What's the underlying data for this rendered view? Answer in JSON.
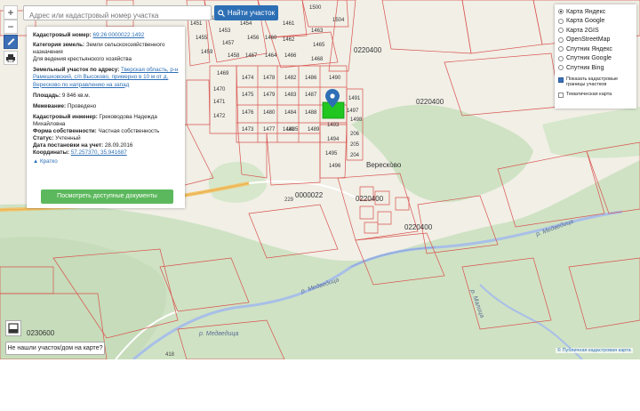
{
  "search": {
    "placeholder": "Адрес или кадастровый номер участка",
    "button_label": "Найти участок"
  },
  "controls": {
    "zoom_in": "+",
    "zoom_out": "−"
  },
  "info_panel": {
    "cadastral_number_label": "Кадастровый номер:",
    "cadastral_number": "69:26:0000022:1492",
    "land_category_label": "Категория земель:",
    "land_category": "Земли сельскохозяйственного назначения",
    "permitted_use": "Для ведения крестьянского хозяйства",
    "address_label": "Земельный участок по адресу:",
    "address": "Тверская область, р-н Рамешковский, с/п Высоково, примерно в 10 м от д. Верескoво по направлению на запад",
    "area_label": "Площадь:",
    "area": "9 846 кв.м.",
    "survey_label": "Межевание:",
    "survey": "Проведено",
    "engineer_label": "Кадастровый инженер:",
    "engineer": "Греководова Надежда Михайловна",
    "ownership_label": "Форма собственности:",
    "ownership": "Частная собственность",
    "status_label": "Статус:",
    "status": "Учтенный",
    "registered_label": "Дата постановки на учет:",
    "registered": "28.09.2016",
    "coords_label": "Координаты:",
    "coords": "57.257370, 35.941687",
    "collapse_label": "Кратко",
    "docs_button": "Посмотреть доступные документы"
  },
  "layers": {
    "options": [
      {
        "label": "Карта Яндекс",
        "selected": true
      },
      {
        "label": "Карта Google",
        "selected": false
      },
      {
        "label": "Карта 2GIS",
        "selected": false
      },
      {
        "label": "OpenStreetMap",
        "selected": false
      },
      {
        "label": "Спутник Яндекс",
        "selected": false
      },
      {
        "label": "Спутник Google",
        "selected": false
      },
      {
        "label": "Спутник Bing",
        "selected": false
      }
    ],
    "show_boundaries": "Показать кадастровые границы участков",
    "show_boundaries_checked": true,
    "thematic_map": "Тематическая карта",
    "thematic_map_checked": false
  },
  "map": {
    "parcels": [
      "1500",
      "1461",
      "1463",
      "1465",
      "1462",
      "1464",
      "1466",
      "1468",
      "1467",
      "1469",
      "1470",
      "1471",
      "1472",
      "1473",
      "1474",
      "1475",
      "1476",
      "1477",
      "1478",
      "1479",
      "1480",
      "1481",
      "1482",
      "1483",
      "1484",
      "1485",
      "1486",
      "1487",
      "1488",
      "1489",
      "1490",
      "1491",
      "1493",
      "1494",
      "1495",
      "1496",
      "1497",
      "1498",
      "206",
      "205",
      "204",
      "1504",
      "1454",
      "1456",
      "1457",
      "1458",
      "1459",
      "1460",
      "1451",
      "1452",
      "1453",
      "1455"
    ],
    "quarters": [
      "0220400",
      "0220400",
      "0000022",
      "0220400",
      "0220400",
      "0230600"
    ],
    "village": "Вереско̀во",
    "rivers": [
      "р. Медведица",
      "р. Медведица",
      "р. Медведица",
      "р. Малица"
    ],
    "roads": [
      "229",
      "418"
    ]
  },
  "not_found_button": "Не нашли участок/дом на карте?",
  "credit": "Публичная кадастровая карта",
  "colors": {
    "accent": "#2d6fb5",
    "selected_parcel": "#21c621",
    "forest": "#cfe2c4",
    "docs_button": "#5cb85c",
    "boundary": "#d9534f"
  }
}
